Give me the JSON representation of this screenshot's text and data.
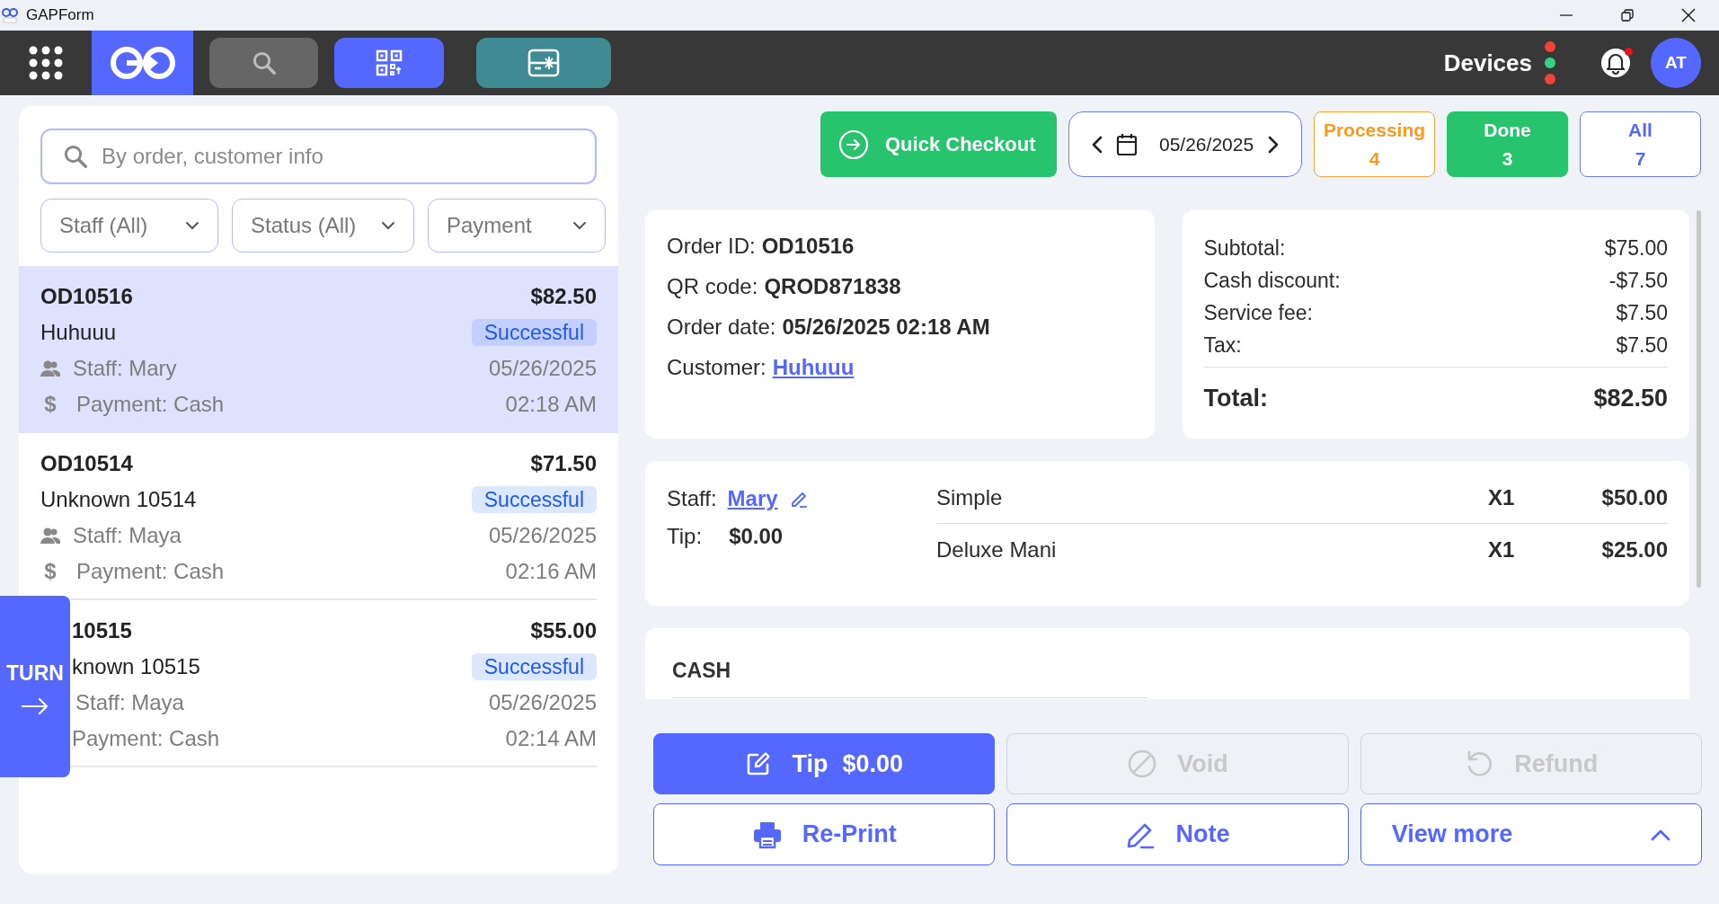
{
  "window": {
    "title": "GAPForm"
  },
  "nav": {
    "devices_label": "Devices",
    "device_dots": [
      {
        "color": "#f04438"
      },
      {
        "color": "#32d583"
      },
      {
        "color": "#f04438"
      }
    ],
    "notification_badge": true,
    "avatar": "AT"
  },
  "search": {
    "placeholder": "By order, customer info"
  },
  "filters": [
    {
      "label": "Staff (All)"
    },
    {
      "label": "Status (All)"
    },
    {
      "label": "Payment"
    }
  ],
  "orders": [
    {
      "id": "OD10516",
      "amount": "$82.50",
      "customer": "Huhuuu",
      "status": "Successful",
      "staff": "Staff: Mary",
      "payment_symbol": "$",
      "payment": "Payment: Cash",
      "date": "05/26/2025",
      "time": "02:18 AM",
      "selected": true,
      "covered": false
    },
    {
      "id": "OD10514",
      "amount": "$71.50",
      "customer": "Unknown 10514",
      "status": "Successful",
      "staff": "Staff: Maya",
      "payment_symbol": "$",
      "payment": "Payment: Cash",
      "date": "05/26/2025",
      "time": "02:16 AM",
      "selected": false,
      "covered": false
    },
    {
      "id": "10515",
      "amount": "$55.00",
      "customer": "known 10515",
      "status": "Successful",
      "staff": "Staff: Maya",
      "payment": "Payment: Cash",
      "date": "05/26/2025",
      "time": "02:14 AM",
      "selected": false,
      "covered": true
    }
  ],
  "turn_tab": {
    "label": "TURN"
  },
  "toolbar": {
    "quick_checkout": "Quick Checkout",
    "date": "05/26/2025",
    "counts": [
      {
        "label": "Processing",
        "count": "4",
        "kind": "processing"
      },
      {
        "label": "Done",
        "count": "3",
        "kind": "done"
      },
      {
        "label": "All",
        "count": "7",
        "kind": "all"
      }
    ]
  },
  "order_info": [
    {
      "label": "Order ID:",
      "value": "OD10516",
      "kind": "text"
    },
    {
      "label": "QR code:",
      "value": "QROD871838",
      "kind": "text"
    },
    {
      "label": "Order date:",
      "value": "05/26/2025 02:18 AM",
      "kind": "text"
    },
    {
      "label": "Customer:",
      "value": "Huhuuu",
      "kind": "link"
    }
  ],
  "totals": [
    {
      "label": "Subtotal:",
      "value": "$75.00"
    },
    {
      "label": "Cash discount:",
      "value": "-$7.50"
    },
    {
      "label": "Service fee:",
      "value": "$7.50"
    },
    {
      "label": "Tax:",
      "value": "$7.50"
    }
  ],
  "total": {
    "label": "Total:",
    "value": "$82.50"
  },
  "staff": {
    "label": "Staff:",
    "name": "Mary"
  },
  "tip": {
    "label": "Tip:",
    "value": "$0.00"
  },
  "items": [
    {
      "name": "Simple",
      "qty": "X1",
      "price": "$50.00"
    },
    {
      "name": "Deluxe Mani",
      "qty": "X1",
      "price": "$25.00"
    }
  ],
  "payment_section": {
    "title": "CASH"
  },
  "actions": [
    {
      "label": "Tip",
      "amount": "$0.00",
      "kind": "primary",
      "disabled": false
    },
    {
      "label": "Void",
      "kind": "plain",
      "disabled": true
    },
    {
      "label": "Refund",
      "kind": "plain",
      "disabled": true
    },
    {
      "label": "Re-Print",
      "kind": "outline",
      "disabled": false
    },
    {
      "label": "Note",
      "kind": "outline",
      "disabled": false
    },
    {
      "label": "View more",
      "kind": "expander",
      "disabled": false
    }
  ]
}
